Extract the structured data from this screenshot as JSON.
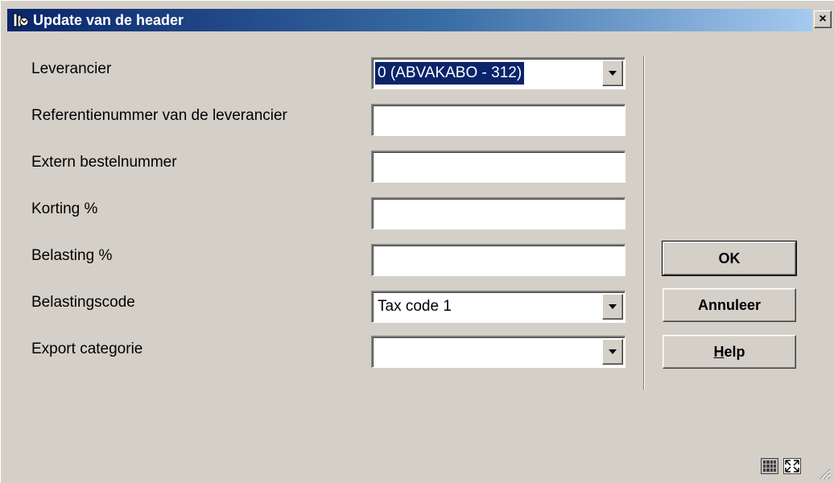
{
  "window": {
    "title": "Update van de header",
    "close_label": "×"
  },
  "form": {
    "fields": [
      {
        "label": "Leverancier",
        "type": "select",
        "value": "0 (ABVAKABO - 312)"
      },
      {
        "label": "Referentienummer van de leverancier",
        "type": "text",
        "value": ""
      },
      {
        "label": "Extern bestelnummer",
        "type": "text",
        "value": ""
      },
      {
        "label": "Korting %",
        "type": "text",
        "value": ""
      },
      {
        "label": "Belasting %",
        "type": "text",
        "value": ""
      },
      {
        "label": "Belastingscode",
        "type": "select",
        "value": "Tax code 1"
      },
      {
        "label": "Export categorie",
        "type": "select",
        "value": ""
      }
    ]
  },
  "buttons": {
    "ok": "OK",
    "cancel": "Annuleer",
    "help_first": "H",
    "help_rest": "elp"
  },
  "icons": {
    "title": "library-app-icon",
    "close": "close-icon",
    "status_left": "calculator-icon",
    "status_right": "expand-icon",
    "resize": "resize-grip-icon"
  },
  "colors": {
    "titlebar_start": "#0a246a",
    "titlebar_end": "#a6caf0",
    "selection": "#0a246a",
    "dialog_bg": "#d4d0c8"
  }
}
